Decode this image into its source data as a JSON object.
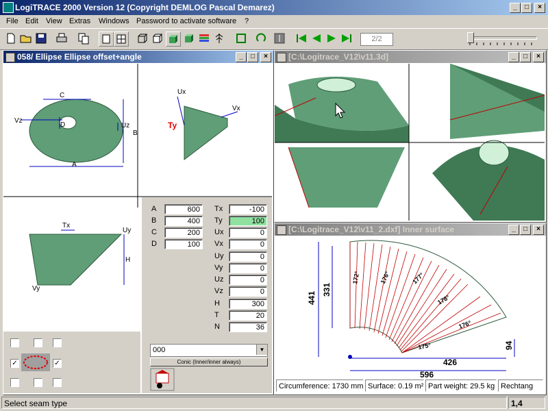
{
  "app": {
    "title": "LogiTRACE 2000  Version 12  (Copyright DEMLOG Pascal Demarez)"
  },
  "menu": [
    "File",
    "Edit",
    "View",
    "Extras",
    "Windows",
    "Password to activate software",
    "?"
  ],
  "toolbar": {
    "page": "2/2"
  },
  "win_left": {
    "title": "058/ Ellipse Ellipse offset+angle",
    "dims": {
      "A": "600",
      "B": "400",
      "C": "200",
      "D": "100"
    },
    "params": {
      "Tx": "-100",
      "Ty": "100",
      "Ux": "0",
      "Vx": "0",
      "Uy": "0",
      "Vy": "0",
      "Uz": "0",
      "Vz": "0",
      "H": "300",
      "T": "20",
      "N": "36"
    },
    "drawing_labels": {
      "A": "A",
      "B": "B",
      "C": "C",
      "D": "D",
      "Ux": "Ux",
      "Uy": "Uy",
      "Uz": "Uz",
      "Vx": "Vx",
      "Vy": "Vy",
      "Vz": "Vz",
      "Tx": "Tx",
      "Ty": "Ty",
      "H": "H"
    },
    "combo_value": "000",
    "conic_button": "Conic (Inner/inner always)"
  },
  "win_3d": {
    "title": "[C:\\Logitrace_V12\\v11.3d]"
  },
  "win_dxf": {
    "title": "[C:\\Logitrace_V12\\v11_2.dxf]  Inner surface",
    "dims": {
      "h1": "441",
      "h2": "331",
      "w1": "426",
      "w2": "596",
      "r": "94"
    },
    "status": {
      "circumference": "Circumference: 1730 mm",
      "surface": "Surface: 0.19 m²",
      "weight": "Part weight: 29.5 kg",
      "shape": "Rechtang"
    }
  },
  "statusbar": {
    "message": "Select seam type",
    "coords": "1,4"
  },
  "colors": {
    "title_active": "#0a246a",
    "cone_green": "#5f9e77",
    "highlight": "#90e0a0"
  }
}
